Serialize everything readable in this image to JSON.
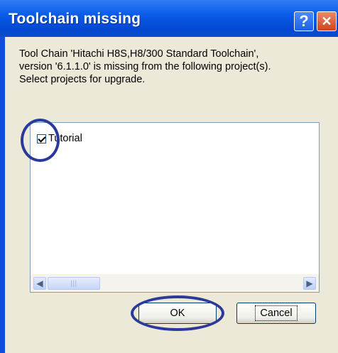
{
  "dialog": {
    "title": "Toolchain missing",
    "message_lines": [
      "Tool Chain 'Hitachi H8S,H8/300 Standard Toolchain',",
      "version '6.1.1.0' is missing from the following project(s).",
      "Select projects for upgrade."
    ],
    "help_glyph": "?",
    "close_glyph": "✕"
  },
  "project_list": {
    "items": [
      {
        "label": "Tutorial",
        "checked": true
      }
    ]
  },
  "scrollbar": {
    "left_glyph": "◀",
    "right_glyph": "▶",
    "thumb_grip": "|||"
  },
  "buttons": {
    "ok_label": "OK",
    "cancel_label": "Cancel"
  },
  "colors": {
    "titlebar": "#0a5ce8",
    "client": "#ece9d8",
    "annotation": "#2b3a9a"
  }
}
